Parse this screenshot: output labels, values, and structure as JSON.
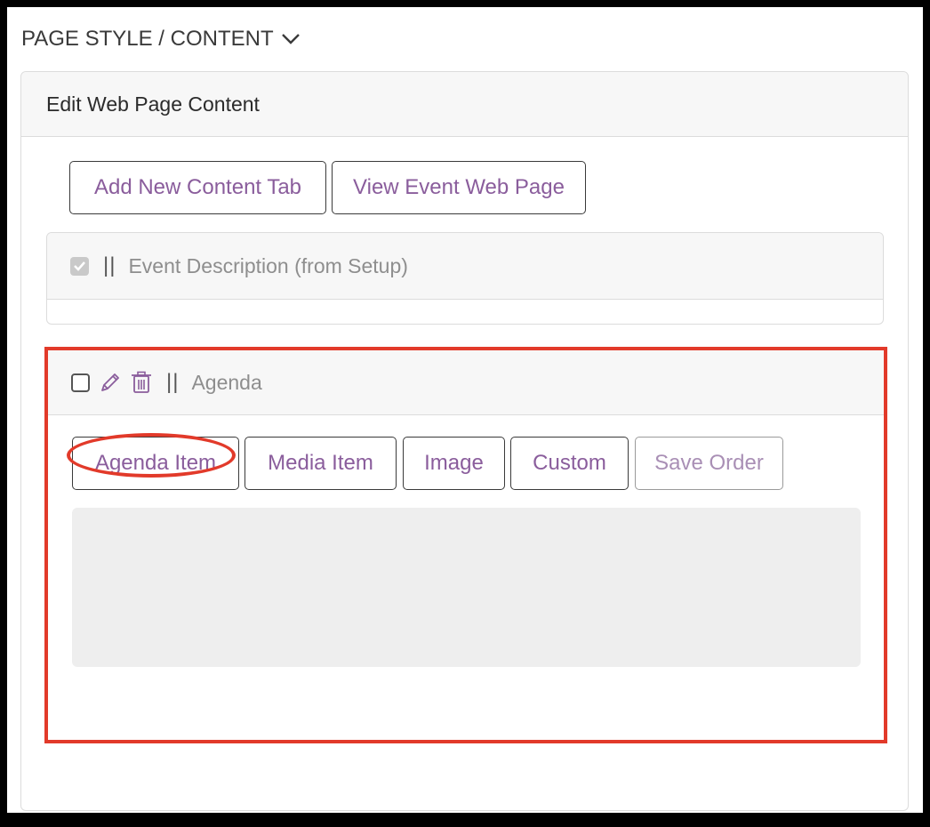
{
  "section": {
    "title": "PAGE STYLE / CONTENT",
    "icon": "chevron-down-icon"
  },
  "card": {
    "title": "Edit Web Page Content"
  },
  "toolbar": {
    "add_tab_label": "Add New Content Tab",
    "view_page_label": "View Event Web Page"
  },
  "tabs": [
    {
      "label": "Event Description (from Setup)",
      "checked": true,
      "grip": "||"
    },
    {
      "label": "Agenda",
      "checked": false,
      "grip": "||",
      "icons": [
        "pencil-icon",
        "trash-icon"
      ]
    }
  ],
  "agenda_buttons": {
    "agenda_item": "Agenda Item",
    "media_item": "Media Item",
    "image": "Image",
    "custom": "Custom",
    "save_order": "Save Order"
  },
  "colors": {
    "accent": "#8a5d9c",
    "highlight": "#e23a2a"
  }
}
